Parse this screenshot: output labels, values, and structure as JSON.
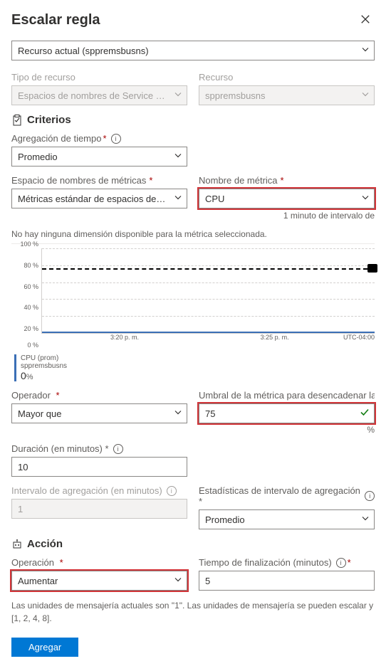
{
  "header": {
    "title": "Escalar regla"
  },
  "resourceSelector": {
    "text": "Recurso actual (sppremsbusns)"
  },
  "resourceType": {
    "label": "Tipo de recurso",
    "value": "Espacios de nombres de Service Bus"
  },
  "resource": {
    "label": "Recurso",
    "value": "sppremsbusns"
  },
  "criteria": {
    "title": "Criterios",
    "timeAgg": {
      "label": "Agregación de tiempo",
      "value": "Promedio"
    },
    "namespace": {
      "label": "Espacio de nombres de métricas",
      "value": "Métricas estándar de espacios de nombres de Service Bus"
    },
    "metricName": {
      "label": "Nombre de métrica",
      "value": "CPU"
    },
    "intervalNote": "1 minuto de intervalo de",
    "noDimNote": "No hay ninguna dimensión disponible para la métrica seleccionada."
  },
  "chart_data": {
    "type": "line",
    "yticks": [
      "100 %",
      "80 %",
      "60 %",
      "40 %",
      "20 %",
      "0 %"
    ],
    "xticks": [
      "3:20 p. m.",
      "3:25 p. m."
    ],
    "timezone": "UTC-04:00",
    "series": [
      {
        "name": "CPU (prom)",
        "resource": "sppremsbusns",
        "current_value": "0",
        "unit": "%"
      }
    ],
    "threshold_line_y": 75
  },
  "operator": {
    "label": "Operador",
    "value": "Mayor que"
  },
  "threshold": {
    "label": "Umbral de la métrica para desencadenar la acción",
    "value": "75",
    "unit": "%"
  },
  "duration": {
    "label": "Duración (en minutos) *",
    "value": "10"
  },
  "aggInterval": {
    "label": "Intervalo de agregación (en minutos)",
    "value": "1"
  },
  "aggStats": {
    "label": "Estadísticas de intervalo de agregación *",
    "value": "Promedio"
  },
  "action": {
    "title": "Acción",
    "operation": {
      "label": "Operación",
      "value": "Aumentar"
    },
    "cooldown": {
      "label": "Tiempo de finalización (minutos)",
      "value": "5"
    }
  },
  "unitsMsg": {
    "line1": "Las unidades de mensajería actuales son \"1\". Las unidades de mensajería se pueden escalar y",
    "line2": "[1, 2, 4, 8]."
  },
  "addButton": "Agregar"
}
